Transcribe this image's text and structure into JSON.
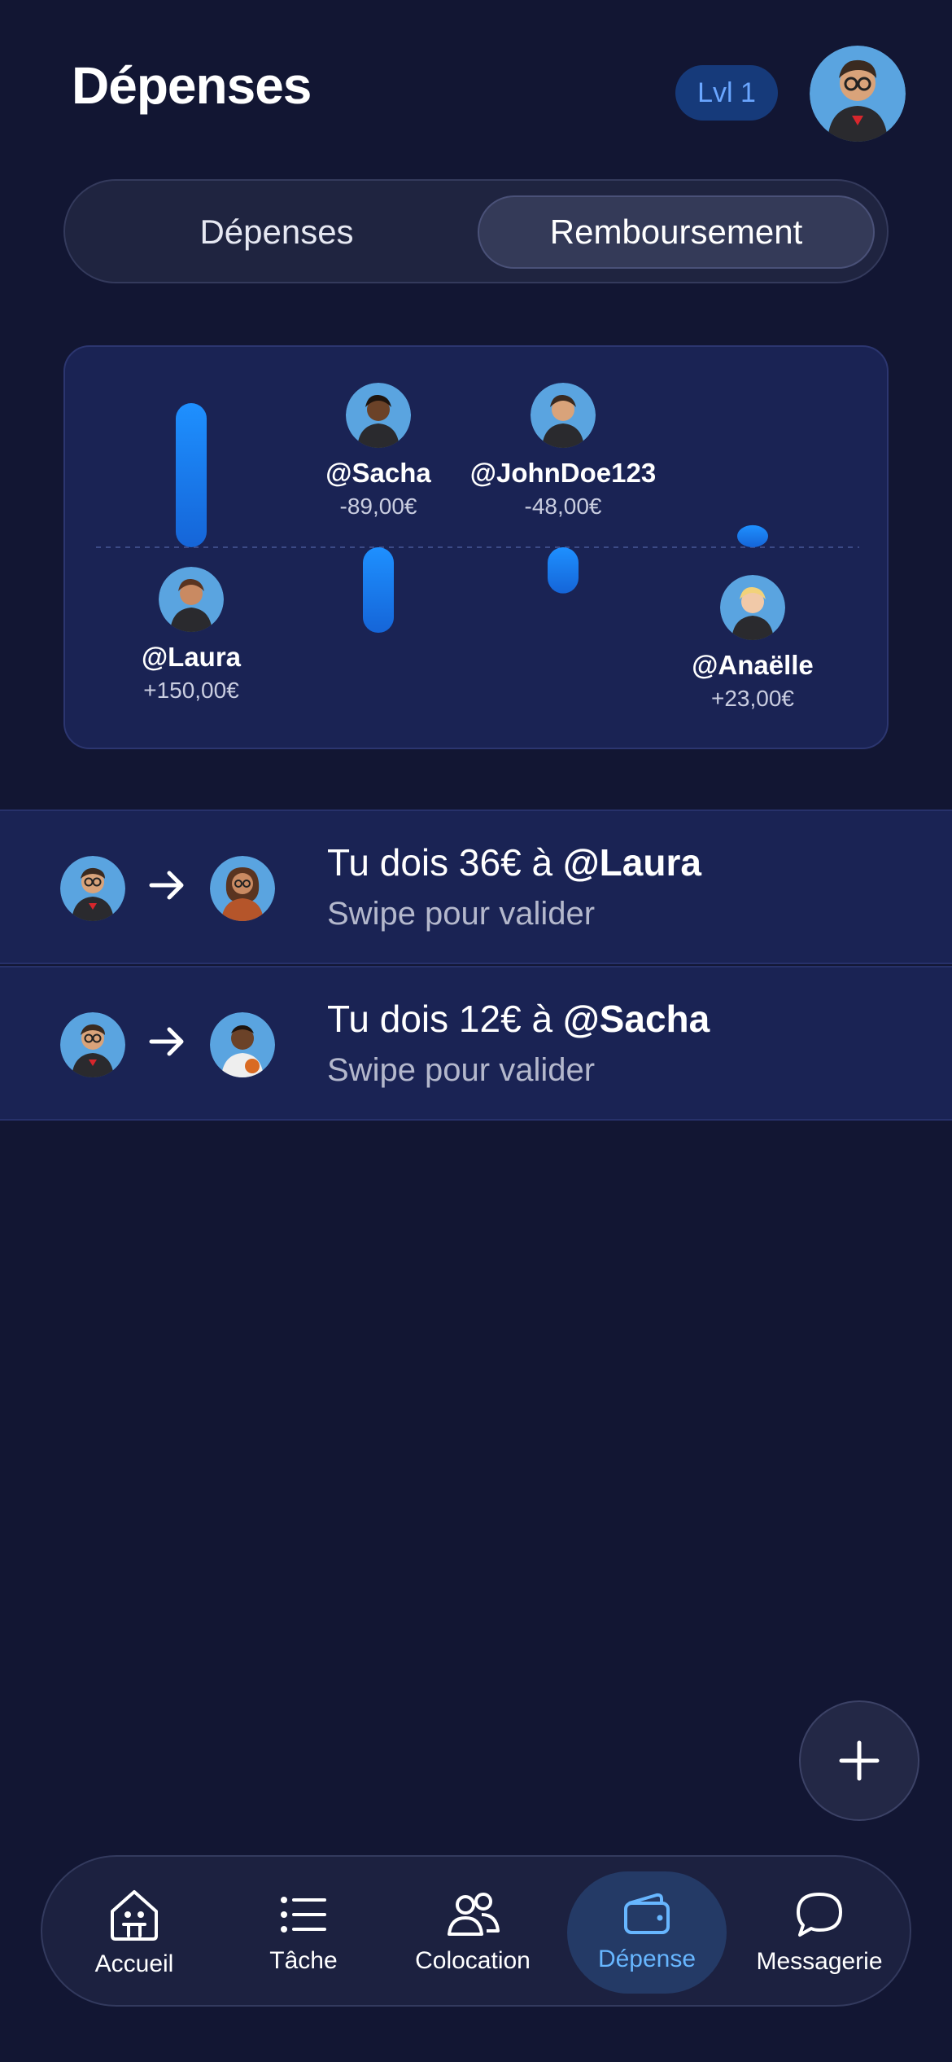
{
  "header": {
    "title": "Dépenses",
    "level_badge": "Lvl 1",
    "avatar_icon": "user-avatar-superhero"
  },
  "segmented": {
    "tabs": [
      {
        "label": "Dépenses",
        "selected": false
      },
      {
        "label": "Remboursement",
        "selected": true
      }
    ]
  },
  "balances": {
    "members": [
      {
        "name": "@Laura",
        "amount_label": "+150,00€",
        "value": 150,
        "avatar_icon": "avatar-laura"
      },
      {
        "name": "@Sacha",
        "amount_label": "-89,00€",
        "value": -89,
        "avatar_icon": "avatar-sacha"
      },
      {
        "name": "@JohnDoe123",
        "amount_label": "-48,00€",
        "value": -48,
        "avatar_icon": "avatar-johndoe"
      },
      {
        "name": "@Anaëlle",
        "amount_label": "+23,00€",
        "value": 23,
        "avatar_icon": "avatar-anaelle"
      }
    ]
  },
  "debts": [
    {
      "prefix": "Tu dois 36€ à ",
      "target": "@Laura",
      "hint": "Swipe pour valider",
      "from_avatar": "avatar-johndoe",
      "to_avatar": "avatar-laura"
    },
    {
      "prefix": "Tu dois 12€ à ",
      "target": "@Sacha",
      "hint": "Swipe pour valider",
      "from_avatar": "avatar-johndoe",
      "to_avatar": "avatar-sacha"
    }
  ],
  "fab": {
    "icon": "plus-icon"
  },
  "nav": {
    "items": [
      {
        "label": "Accueil",
        "icon": "home-icon",
        "active": false
      },
      {
        "label": "Tâche",
        "icon": "list-icon",
        "active": false
      },
      {
        "label": "Colocation",
        "icon": "people-icon",
        "active": false
      },
      {
        "label": "Dépense",
        "icon": "wallet-icon",
        "active": true
      },
      {
        "label": "Messagerie",
        "icon": "chat-icon",
        "active": false
      }
    ]
  },
  "colors": {
    "background": "#121633",
    "card": "#1a2354",
    "bar": "#1e88e5",
    "accent": "#67b6ff",
    "badge": "#163a7a"
  }
}
